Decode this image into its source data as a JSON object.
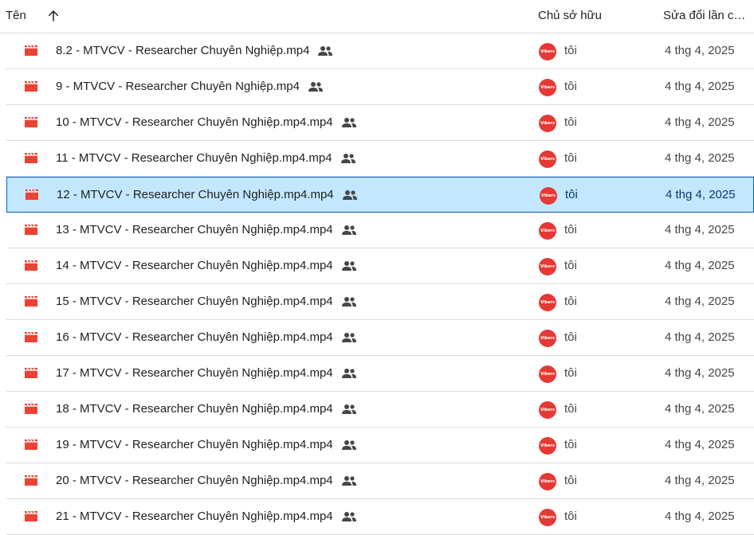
{
  "header": {
    "name_label": "Tên",
    "owner_label": "Chủ sở hữu",
    "modified_label": "Sửa đổi lần c…"
  },
  "files": [
    {
      "name": "8.2 - MTVCV - Researcher Chuyên Nghiệp.mp4",
      "owner": "tôi",
      "avatar_text": "Vibers",
      "modified": "4 thg 4, 2025",
      "selected": false
    },
    {
      "name": "9 - MTVCV - Researcher Chuyên Nghiệp.mp4",
      "owner": "tôi",
      "avatar_text": "Vibers",
      "modified": "4 thg 4, 2025",
      "selected": false
    },
    {
      "name": "10 - MTVCV - Researcher Chuyên Nghiệp.mp4.mp4",
      "owner": "tôi",
      "avatar_text": "Vibers",
      "modified": "4 thg 4, 2025",
      "selected": false
    },
    {
      "name": "11 - MTVCV - Researcher Chuyên Nghiệp.mp4.mp4",
      "owner": "tôi",
      "avatar_text": "Vibers",
      "modified": "4 thg 4, 2025",
      "selected": false
    },
    {
      "name": "12 - MTVCV - Researcher Chuyên Nghiệp.mp4.mp4",
      "owner": "tôi",
      "avatar_text": "Vibers",
      "modified": "4 thg 4, 2025",
      "selected": true
    },
    {
      "name": "13 - MTVCV - Researcher Chuyên Nghiệp.mp4.mp4",
      "owner": "tôi",
      "avatar_text": "Vibers",
      "modified": "4 thg 4, 2025",
      "selected": false
    },
    {
      "name": "14 - MTVCV - Researcher Chuyên Nghiệp.mp4.mp4",
      "owner": "tôi",
      "avatar_text": "Vibers",
      "modified": "4 thg 4, 2025",
      "selected": false
    },
    {
      "name": "15 - MTVCV - Researcher Chuyên Nghiệp.mp4.mp4",
      "owner": "tôi",
      "avatar_text": "Vibers",
      "modified": "4 thg 4, 2025",
      "selected": false
    },
    {
      "name": "16 - MTVCV - Researcher Chuyên Nghiệp.mp4.mp4",
      "owner": "tôi",
      "avatar_text": "Vibers",
      "modified": "4 thg 4, 2025",
      "selected": false
    },
    {
      "name": "17 - MTVCV - Researcher Chuyên Nghiệp.mp4.mp4",
      "owner": "tôi",
      "avatar_text": "Vibers",
      "modified": "4 thg 4, 2025",
      "selected": false
    },
    {
      "name": "18 - MTVCV - Researcher Chuyên Nghiệp.mp4.mp4",
      "owner": "tôi",
      "avatar_text": "Vibers",
      "modified": "4 thg 4, 2025",
      "selected": false
    },
    {
      "name": "19 - MTVCV - Researcher Chuyên Nghiệp.mp4.mp4",
      "owner": "tôi",
      "avatar_text": "Vibers",
      "modified": "4 thg 4, 2025",
      "selected": false
    },
    {
      "name": "20 - MTVCV - Researcher Chuyên Nghiệp.mp4.mp4",
      "owner": "tôi",
      "avatar_text": "Vibers",
      "modified": "4 thg 4, 2025",
      "selected": false
    },
    {
      "name": "21 - MTVCV - Researcher Chuyên Nghiệp.mp4.mp4",
      "owner": "tôi",
      "avatar_text": "Vibers",
      "modified": "4 thg 4, 2025",
      "selected": false
    }
  ],
  "icons": {
    "sort": "arrow-up-icon",
    "file": "video-file-icon",
    "shared": "people-icon"
  },
  "colors": {
    "file_icon": "#ea4335",
    "selected_bg": "#c2e7ff",
    "selected_border": "#0b57d0",
    "avatar_bg": "#e53935"
  }
}
